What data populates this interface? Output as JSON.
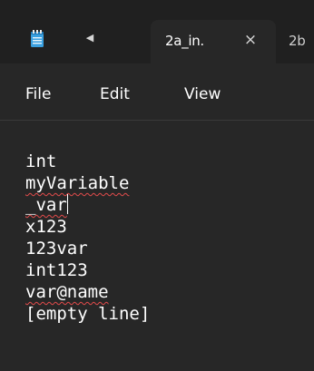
{
  "tabs": {
    "active_label": "2a_in.",
    "close_glyph": "×",
    "next_label": "2b",
    "scroll_left_glyph": "◀"
  },
  "menu": {
    "file": "File",
    "edit": "Edit",
    "view": "View"
  },
  "editor": {
    "lines": [
      "int",
      "myVariable",
      "_var",
      "x123",
      "123var",
      "int123",
      "var@name",
      "[empty line]"
    ],
    "spellcheck_flagged_lines": [
      1,
      2,
      6
    ]
  },
  "colors": {
    "background": "#272727",
    "tabbar": "#202020",
    "text": "#ffffff",
    "spellcheck_underline": "#e34b4b",
    "notepad_icon": "#3aa0e0"
  },
  "icons": {
    "app": "notepad-icon",
    "scroll_left": "chevron-left-icon",
    "close": "close-icon"
  }
}
